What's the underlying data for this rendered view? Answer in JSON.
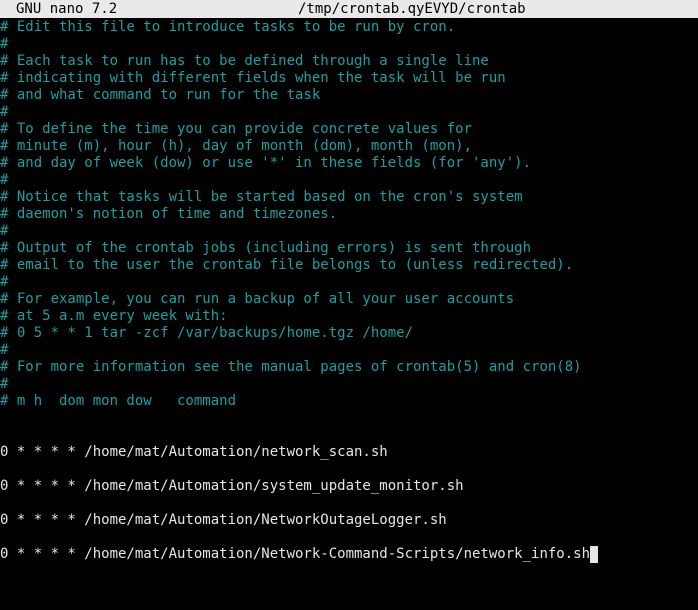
{
  "titlebar": {
    "app": "GNU nano 7.2",
    "file": "/tmp/crontab.qyEVYD/crontab"
  },
  "lines": [
    "# Edit this file to introduce tasks to be run by cron.",
    "#",
    "# Each task to run has to be defined through a single line",
    "# indicating with different fields when the task will be run",
    "# and what command to run for the task",
    "#",
    "# To define the time you can provide concrete values for",
    "# minute (m), hour (h), day of month (dom), month (mon),",
    "# and day of week (dow) or use '*' in these fields (for 'any').",
    "#",
    "# Notice that tasks will be started based on the cron's system",
    "# daemon's notion of time and timezones.",
    "#",
    "# Output of the crontab jobs (including errors) is sent through",
    "# email to the user the crontab file belongs to (unless redirected).",
    "#",
    "# For example, you can run a backup of all your user accounts",
    "# at 5 a.m every week with:",
    "# 0 5 * * 1 tar -zcf /var/backups/home.tgz /home/",
    "#",
    "# For more information see the manual pages of crontab(5) and cron(8)",
    "#",
    "# m h  dom mon dow   command",
    "",
    "",
    "0 * * * * /home/mat/Automation/network_scan.sh",
    "",
    "0 * * * * /home/mat/Automation/system_update_monitor.sh",
    "",
    "0 * * * * /home/mat/Automation/NetworkOutageLogger.sh",
    "",
    "0 * * * * /home/mat/Automation/Network-Command-Scripts/network_info.sh"
  ],
  "colors": {
    "comment": "#1aa0a0",
    "code": "#e6e6e6",
    "titlebar_bg": "#e9e9e9",
    "background": "#000000"
  }
}
